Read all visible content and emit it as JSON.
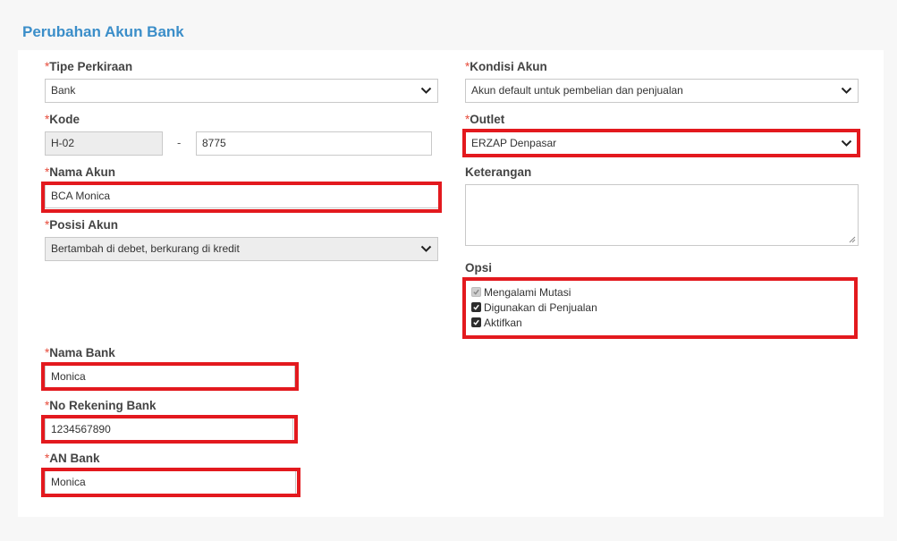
{
  "page": {
    "title": "Perubahan Akun Bank"
  },
  "form": {
    "required_mark": "*",
    "tipe_perkiraan": {
      "label": "Tipe Perkiraan",
      "value": "Bank"
    },
    "kode": {
      "label": "Kode",
      "prefix": "H-02",
      "separator": "-",
      "value": "8775"
    },
    "nama_akun": {
      "label": "Nama Akun",
      "value": "BCA Monica"
    },
    "posisi_akun": {
      "label": "Posisi Akun",
      "value": "Bertambah di debet, berkurang di kredit"
    },
    "kondisi_akun": {
      "label": "Kondisi Akun",
      "value": "Akun default untuk pembelian dan penjualan"
    },
    "outlet": {
      "label": "Outlet",
      "value": "ERZAP Denpasar"
    },
    "keterangan": {
      "label": "Keterangan",
      "value": ""
    },
    "opsi": {
      "label": "Opsi",
      "items": [
        {
          "label": "Mengalami Mutasi",
          "checked": true,
          "disabled": true
        },
        {
          "label": "Digunakan di Penjualan",
          "checked": true,
          "disabled": false
        },
        {
          "label": "Aktifkan",
          "checked": true,
          "disabled": false
        }
      ]
    },
    "nama_bank": {
      "label": "Nama Bank",
      "value": "Monica"
    },
    "no_rekening_bank": {
      "label": "No Rekening Bank",
      "value": "1234567890"
    },
    "an_bank": {
      "label": "AN Bank",
      "value": "Monica"
    }
  },
  "colors": {
    "accent": "#3b8ec9",
    "highlight": "#e3191e",
    "required": "#e74c3c"
  },
  "icons": {
    "select_arrow": "chevron-down-icon",
    "checkbox_check": "check-icon"
  }
}
